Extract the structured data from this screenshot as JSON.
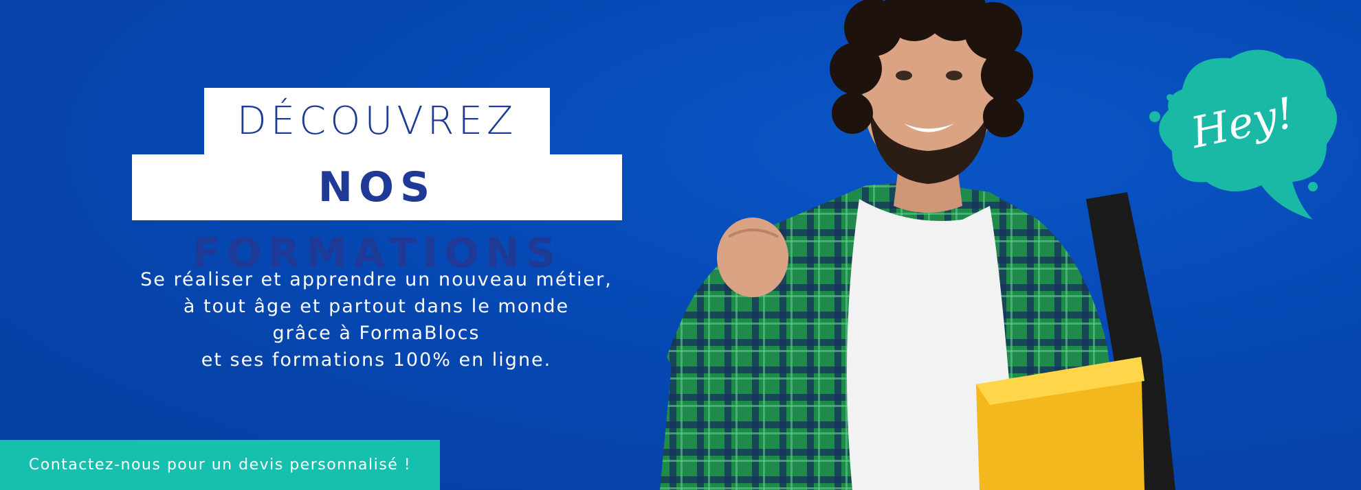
{
  "hero": {
    "title_line1": "DÉCOUVREZ",
    "title_line2": "NOS FORMATIONS",
    "description": [
      "Se réaliser et apprendre un nouveau métier,",
      "à tout âge et partout dans le monde",
      "grâce à FormaBlocs",
      "et ses formations 100% en ligne."
    ],
    "cta_label": "Contactez-nous pour un devis personnalisé !",
    "bubble_text": "Hey!"
  },
  "colors": {
    "background": "#0648b4",
    "title_text": "#1e3a96",
    "accent": "#16bfae"
  },
  "icons": {
    "bubble": "speech-bubble-icon"
  }
}
